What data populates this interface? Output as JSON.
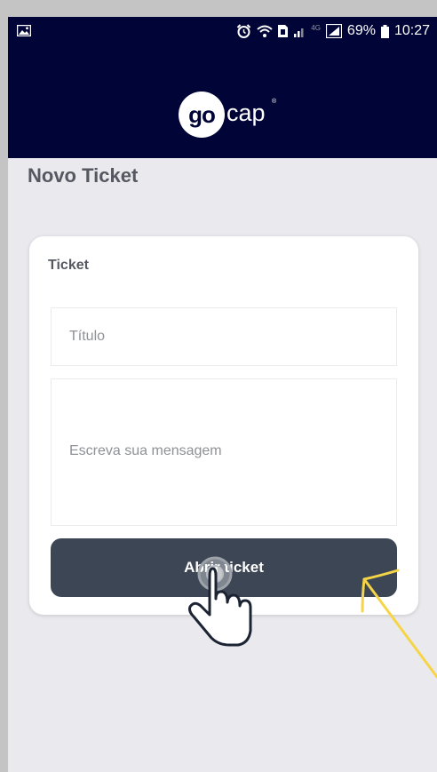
{
  "status_bar": {
    "battery_percent": "69%",
    "time": "10:27",
    "network_type": "4G",
    "icons": [
      "gallery-icon",
      "alarm-icon",
      "wifi-icon",
      "sim-icon",
      "signal-icon",
      "battery-icon"
    ]
  },
  "header": {
    "logo_go": "go",
    "logo_cap": "cap",
    "logo_reg": "®"
  },
  "page": {
    "title": "Novo Ticket"
  },
  "form": {
    "section_label": "Ticket",
    "title_placeholder": "Título",
    "message_placeholder": "Escreva sua mensagem",
    "submit_label": "Abrir ticket"
  },
  "colors": {
    "header_bg": "#000436",
    "page_bg": "#e9e9ee",
    "button_bg": "#3c4654",
    "annotation_arrow": "#f5d547"
  },
  "annotations": [
    "tap-hand-icon",
    "arrow-annotation"
  ]
}
